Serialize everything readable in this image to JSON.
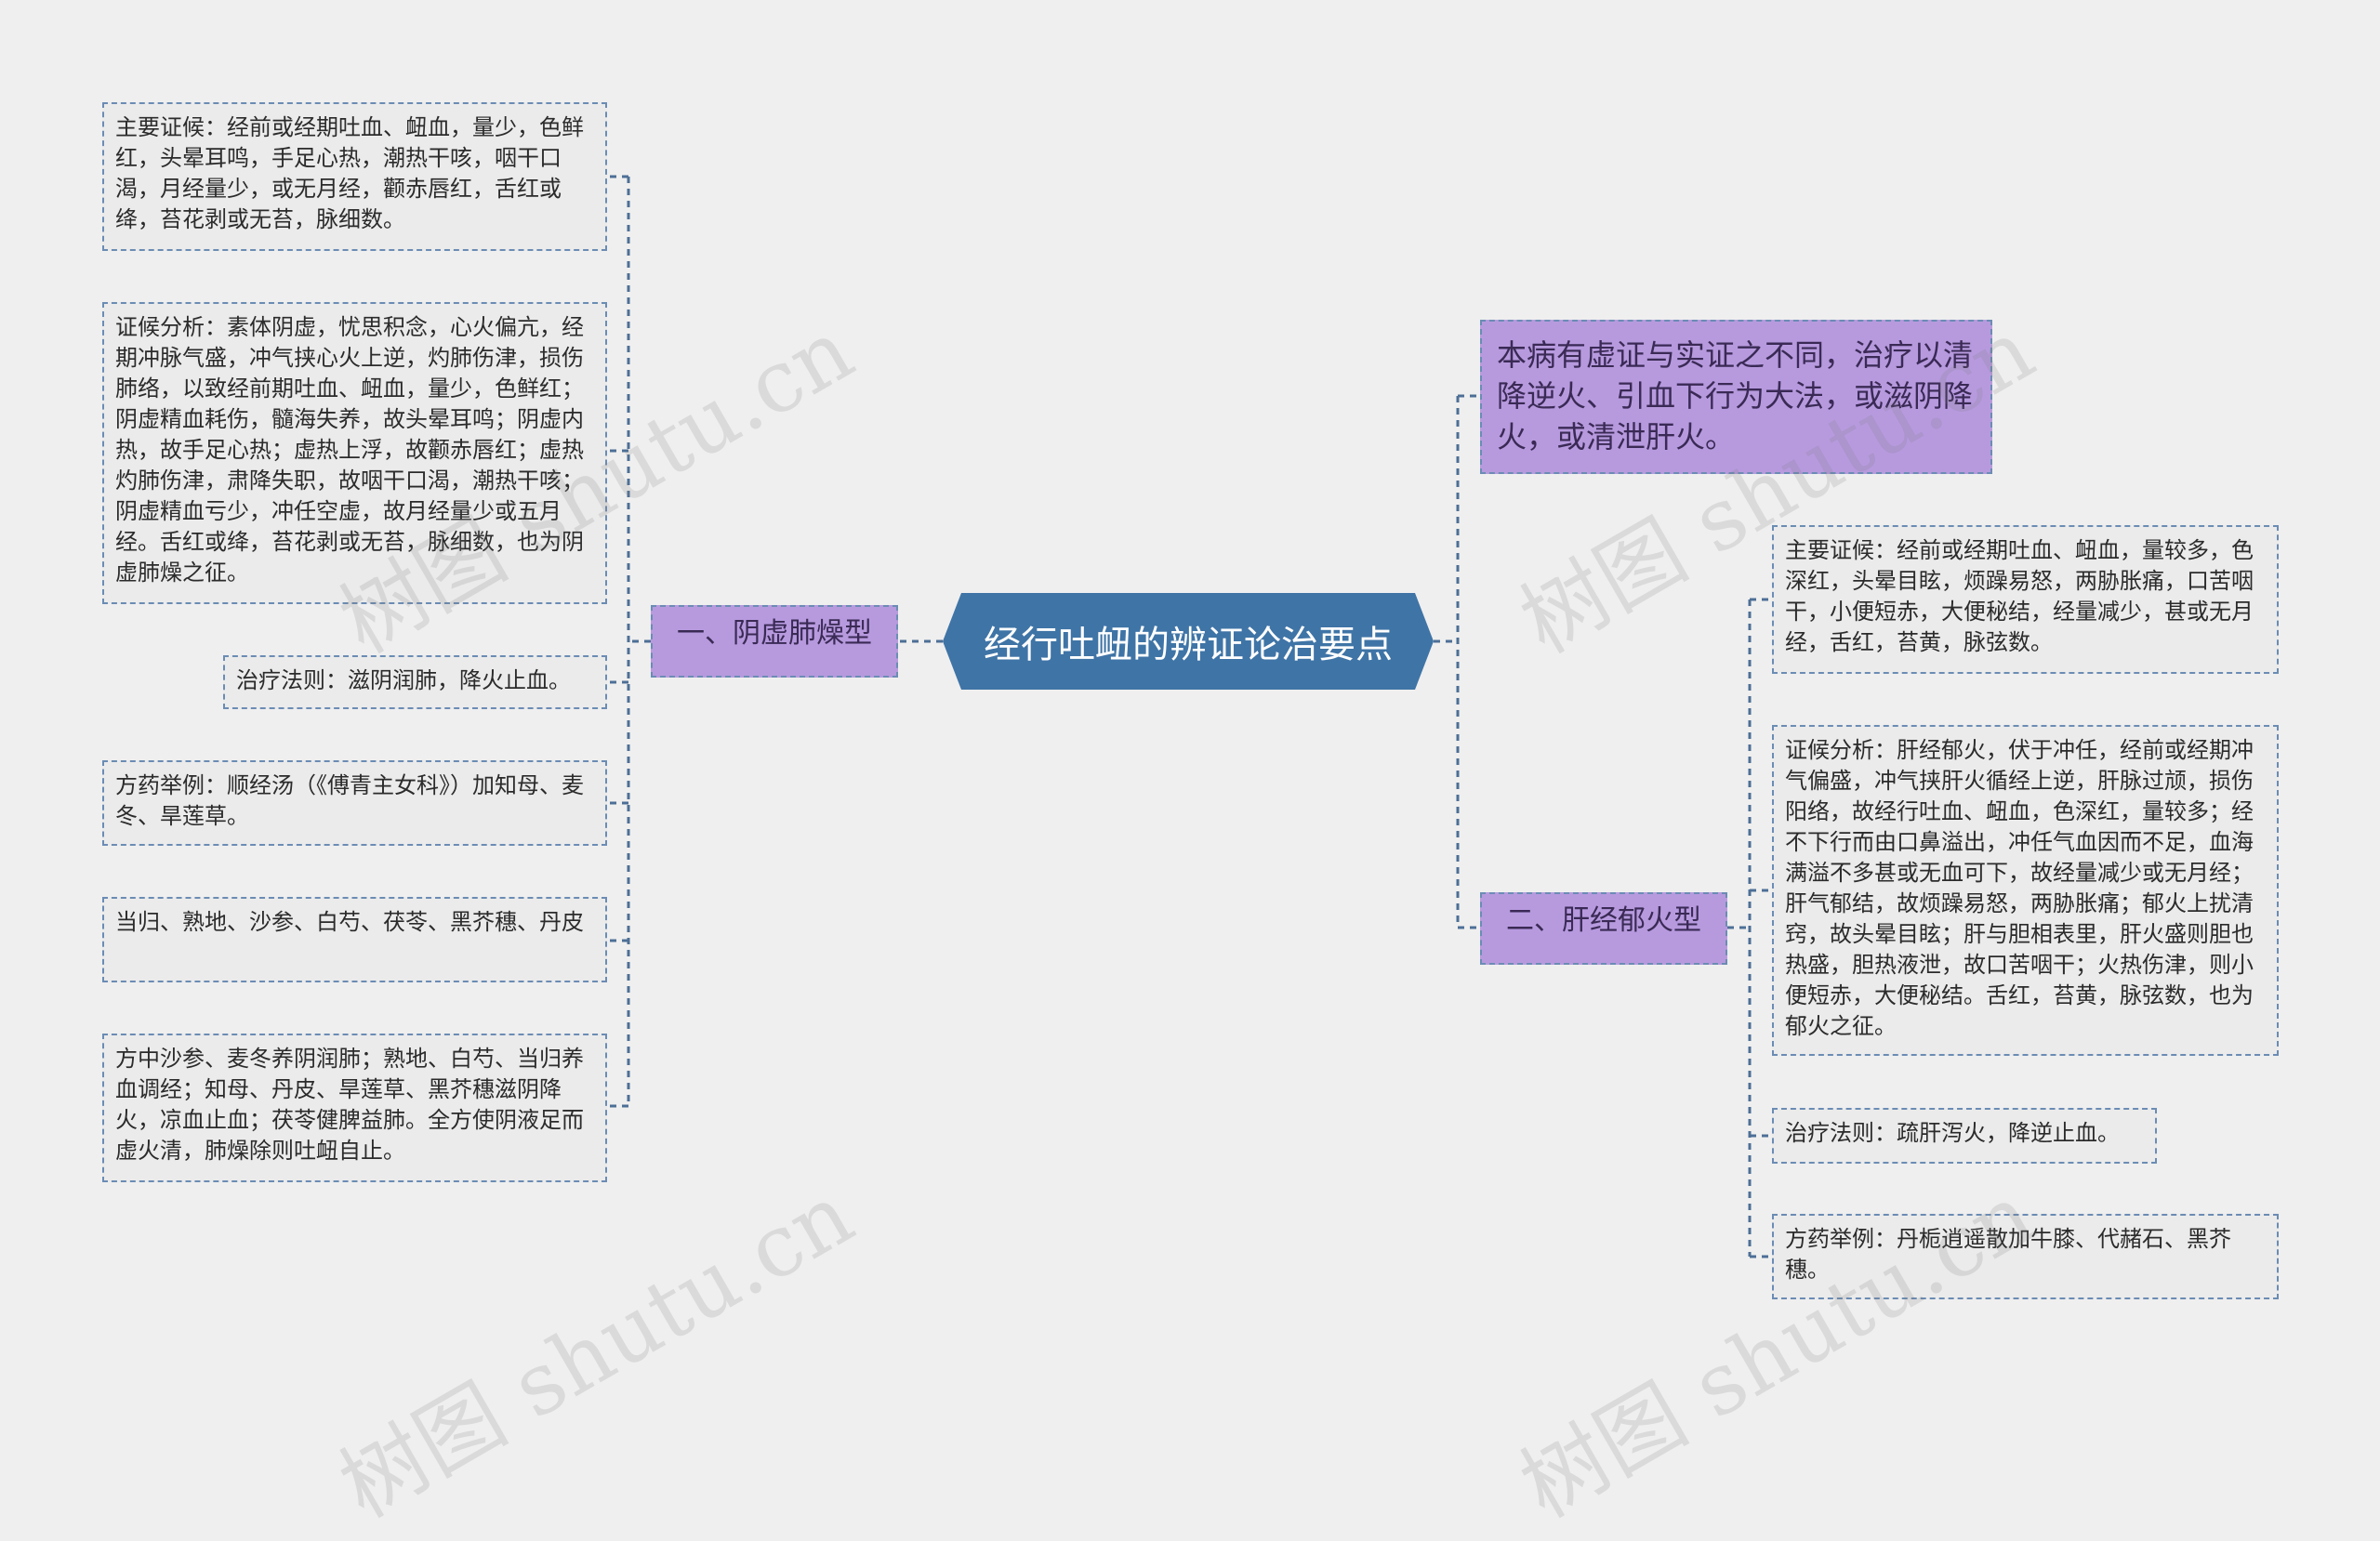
{
  "center": {
    "title": "经行吐衄的辨证论治要点",
    "color": "#3f74a6"
  },
  "left_branch": {
    "label": "一、阴虚肺燥型",
    "items": [
      "主要证候：经前或经期吐血、衄血，量少，色鲜红，头晕耳鸣，手足心热，潮热干咳，咽干口渴，月经量少，或无月经，颧赤唇红，舌红或绛，苔花剥或无苔，脉细数。",
      "证候分析：素体阴虚，忧思积念，心火偏亢，经期冲脉气盛，冲气挟心火上逆，灼肺伤津，损伤肺络，以致经前期吐血、衄血，量少，色鲜红；阴虚精血耗伤，髓海失养，故头晕耳鸣；阴虚内热，故手足心热；虚热上浮，故颧赤唇红；虚热灼肺伤津，肃降失职，故咽干口渴，潮热干咳；阴虚精血亏少，冲任空虚，故月经量少或五月经。舌红或绛，苔花剥或无苔，脉细数，也为阴虚肺燥之征。",
      "治疗法则：滋阴润肺，降火止血。",
      "方药举例：顺经汤（《傅青主女科》）加知母、麦冬、旱莲草。",
      "当归、熟地、沙参、白芍、茯苓、黑芥穗、丹皮",
      "方中沙参、麦冬养阴润肺；熟地、白芍、当归养血调经；知母、丹皮、旱莲草、黑芥穗滋阴降火，凉血止血；茯苓健脾益肺。全方使阴液足而虚火清，肺燥除则吐衄自止。"
    ]
  },
  "right_top": {
    "text": "本病有虚证与实证之不同，治疗以清降逆火、引血下行为大法，或滋阴降火，或清泄肝火。"
  },
  "right_branch": {
    "label": "二、肝经郁火型",
    "items": [
      "主要证候：经前或经期吐血、衄血，量较多，色深红，头晕目眩，烦躁易怒，两胁胀痛，口苦咽干，小便短赤，大便秘结，经量减少，甚或无月经，舌红，苔黄，脉弦数。",
      "证候分析：肝经郁火，伏于冲任，经前或经期冲气偏盛，冲气挟肝火循经上逆，肝脉过颃，损伤阳络，故经行吐血、衄血，色深红，量较多；经不下行而由口鼻溢出，冲任气血因而不足，血海满溢不多甚或无血可下，故经量减少或无月经；肝气郁结，故烦躁易怒，两胁胀痛；郁火上扰清窍，故头晕目眩；肝与胆相表里，肝火盛则胆也热盛，胆热液泄，故口苦咽干；火热伤津，则小便短赤，大便秘结。舌红，苔黄，脉弦数，也为郁火之征。",
      "治疗法则：疏肝泻火，降逆止血。",
      "方药举例：丹栀逍遥散加牛膝、代赭石、黑芥穗。"
    ]
  },
  "watermark": {
    "text": "树图 shutu.cn"
  },
  "colors": {
    "line": "#4d6f96",
    "leaf_border": "#6b8cb4",
    "branch_fill": "#b79ade"
  }
}
